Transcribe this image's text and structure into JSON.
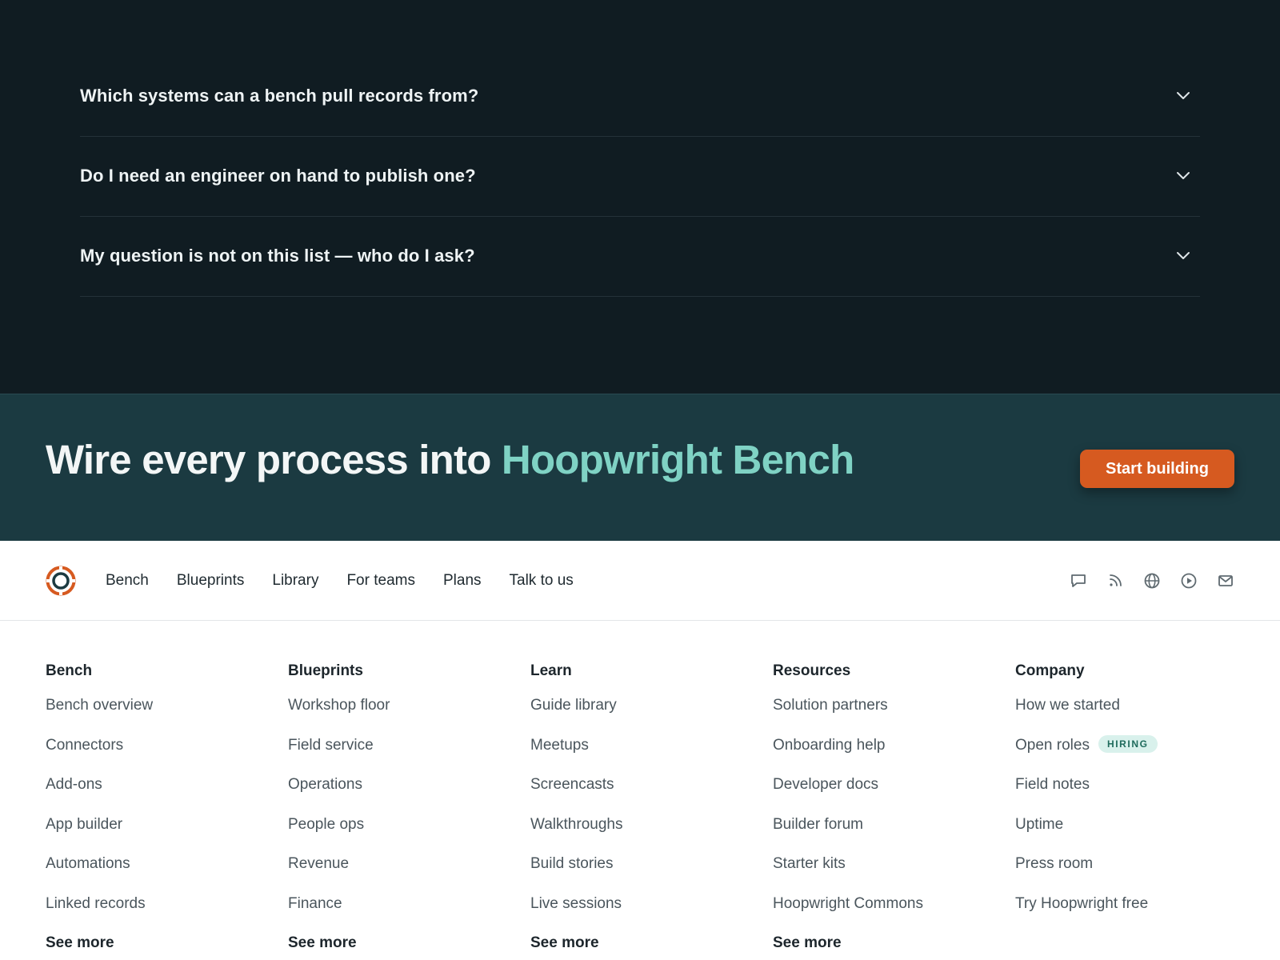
{
  "faq": {
    "items": [
      {
        "question": "Which systems can a bench pull records from?"
      },
      {
        "question": "Do I need an engineer on hand to publish one?"
      },
      {
        "question": "My question is not on this list — who do I ask?"
      }
    ]
  },
  "cta": {
    "title_prefix": "Wire every process into ",
    "title_accent": "Hoopwright Bench",
    "button_label": "Start building",
    "accent_color": "#7fd2c4",
    "button_color": "#d65a20"
  },
  "footer_nav": {
    "links": [
      "Bench",
      "Blueprints",
      "Library",
      "For teams",
      "Plans",
      "Talk to us"
    ],
    "social_icons": [
      "chat-icon",
      "rss-icon",
      "globe-icon",
      "play-icon",
      "mail-icon"
    ]
  },
  "footer_columns": [
    {
      "heading": "Bench",
      "items": [
        "Bench overview",
        "Connectors",
        "Add-ons",
        "App builder",
        "Automations",
        "Linked records"
      ],
      "more": "See more"
    },
    {
      "heading": "Blueprints",
      "items": [
        "Workshop floor",
        "Field service",
        "Operations",
        "People ops",
        "Revenue",
        "Finance"
      ],
      "more": "See more"
    },
    {
      "heading": "Learn",
      "items": [
        "Guide library",
        "Meetups",
        "Screencasts",
        "Walkthroughs",
        "Build stories",
        "Live sessions"
      ],
      "more": "See more"
    },
    {
      "heading": "Resources",
      "items": [
        "Solution partners",
        "Onboarding help",
        "Developer docs",
        "Builder forum",
        "Starter kits",
        "Hoopwright Commons"
      ],
      "more": "See more"
    },
    {
      "heading": "Company",
      "items": [
        "How we started",
        "Open roles",
        "Field notes",
        "Uptime",
        "Press room",
        "Try Hoopwright free"
      ],
      "badge": "HIRING"
    }
  ]
}
